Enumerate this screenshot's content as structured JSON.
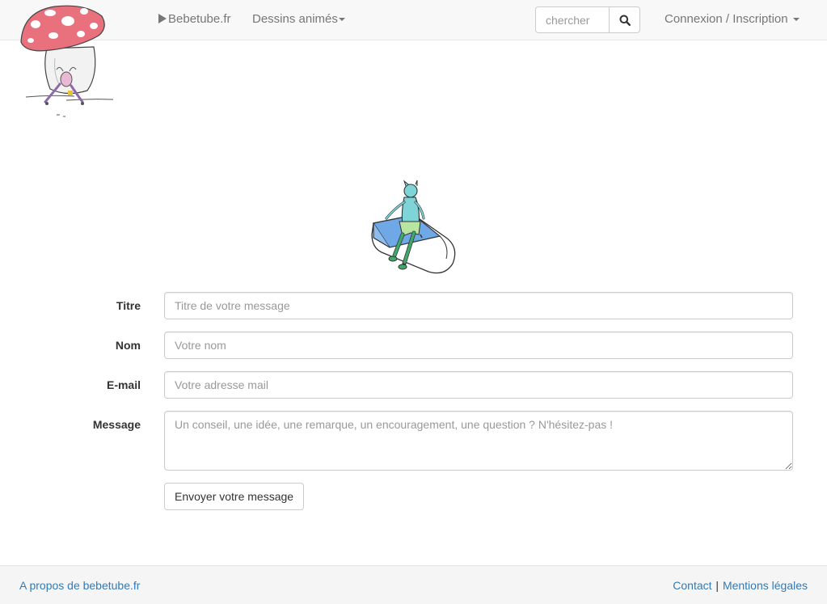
{
  "navbar": {
    "brand_label": "Bebetube.fr",
    "dessins_label": "Dessins animés",
    "search_placeholder": "chercher",
    "account_label": "Connexion / Inscription"
  },
  "form": {
    "titre_label": "Titre",
    "titre_placeholder": "Titre de votre message",
    "nom_label": "Nom",
    "nom_placeholder": "Votre nom",
    "email_label": "E-mail",
    "email_placeholder": "Votre adresse mail",
    "message_label": "Message",
    "message_placeholder": "Un conseil, une idée, une remarque, un encouragement, une question ? N'hésitez-pas !",
    "submit_label": "Envoyer votre message"
  },
  "footer": {
    "about_label": "A propos de bebetube.fr",
    "contact_label": "Contact",
    "separator": "|",
    "legal_label": "Mentions légales"
  },
  "colors": {
    "navbar_bg": "#f8f8f8",
    "link": "#337ab7",
    "mushroom_cap": "#e9707d"
  },
  "icons": [
    "play-icon",
    "caret-down-icon",
    "search-icon"
  ]
}
